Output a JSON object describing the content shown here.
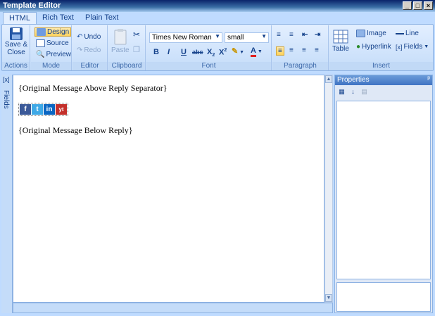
{
  "window": {
    "title": "Template Editor"
  },
  "tabs": [
    {
      "label": "HTML",
      "active": true
    },
    {
      "label": "Rich Text",
      "active": false
    },
    {
      "label": "Plain Text",
      "active": false
    }
  ],
  "ribbon": {
    "actions": {
      "save_close_label_1": "Save &",
      "save_close_label_2": "Close",
      "group_label": "Actions"
    },
    "mode": {
      "design": "Design",
      "source": "Source",
      "preview": "Preview",
      "group_label": "Mode"
    },
    "editor": {
      "undo": "Undo",
      "redo": "Redo",
      "group_label": "Editor"
    },
    "clipboard": {
      "paste": "Paste",
      "group_label": "Clipboard"
    },
    "font": {
      "family": "Times New Roman",
      "size": "small",
      "group_label": "Font",
      "bold": "B",
      "italic": "I",
      "underline": "U",
      "strike": "abc",
      "subscript": "X",
      "superscript": "X"
    },
    "paragraph": {
      "group_label": "Paragraph"
    },
    "insert": {
      "table": "Table",
      "image": "Image",
      "line": "Line",
      "hyperlink": "Hyperlink",
      "fields": "Fields",
      "group_label": "Insert"
    }
  },
  "sidebar": {
    "label": "Fields"
  },
  "document": {
    "line1": "{Original Message Above Reply Separator}",
    "line2": "{Original Message Below Reply}",
    "social": [
      "f",
      "t",
      "in",
      "yt"
    ]
  },
  "properties": {
    "title": "Properties",
    "pin": "ᵖ"
  },
  "colors": {
    "accent": "#15428b",
    "ribbon_bg": "#c4dcf9",
    "facebook": "#3b5998",
    "twitter": "#3fa9e6",
    "linkedin": "#0a66c2",
    "youtube": "#c4302b"
  }
}
